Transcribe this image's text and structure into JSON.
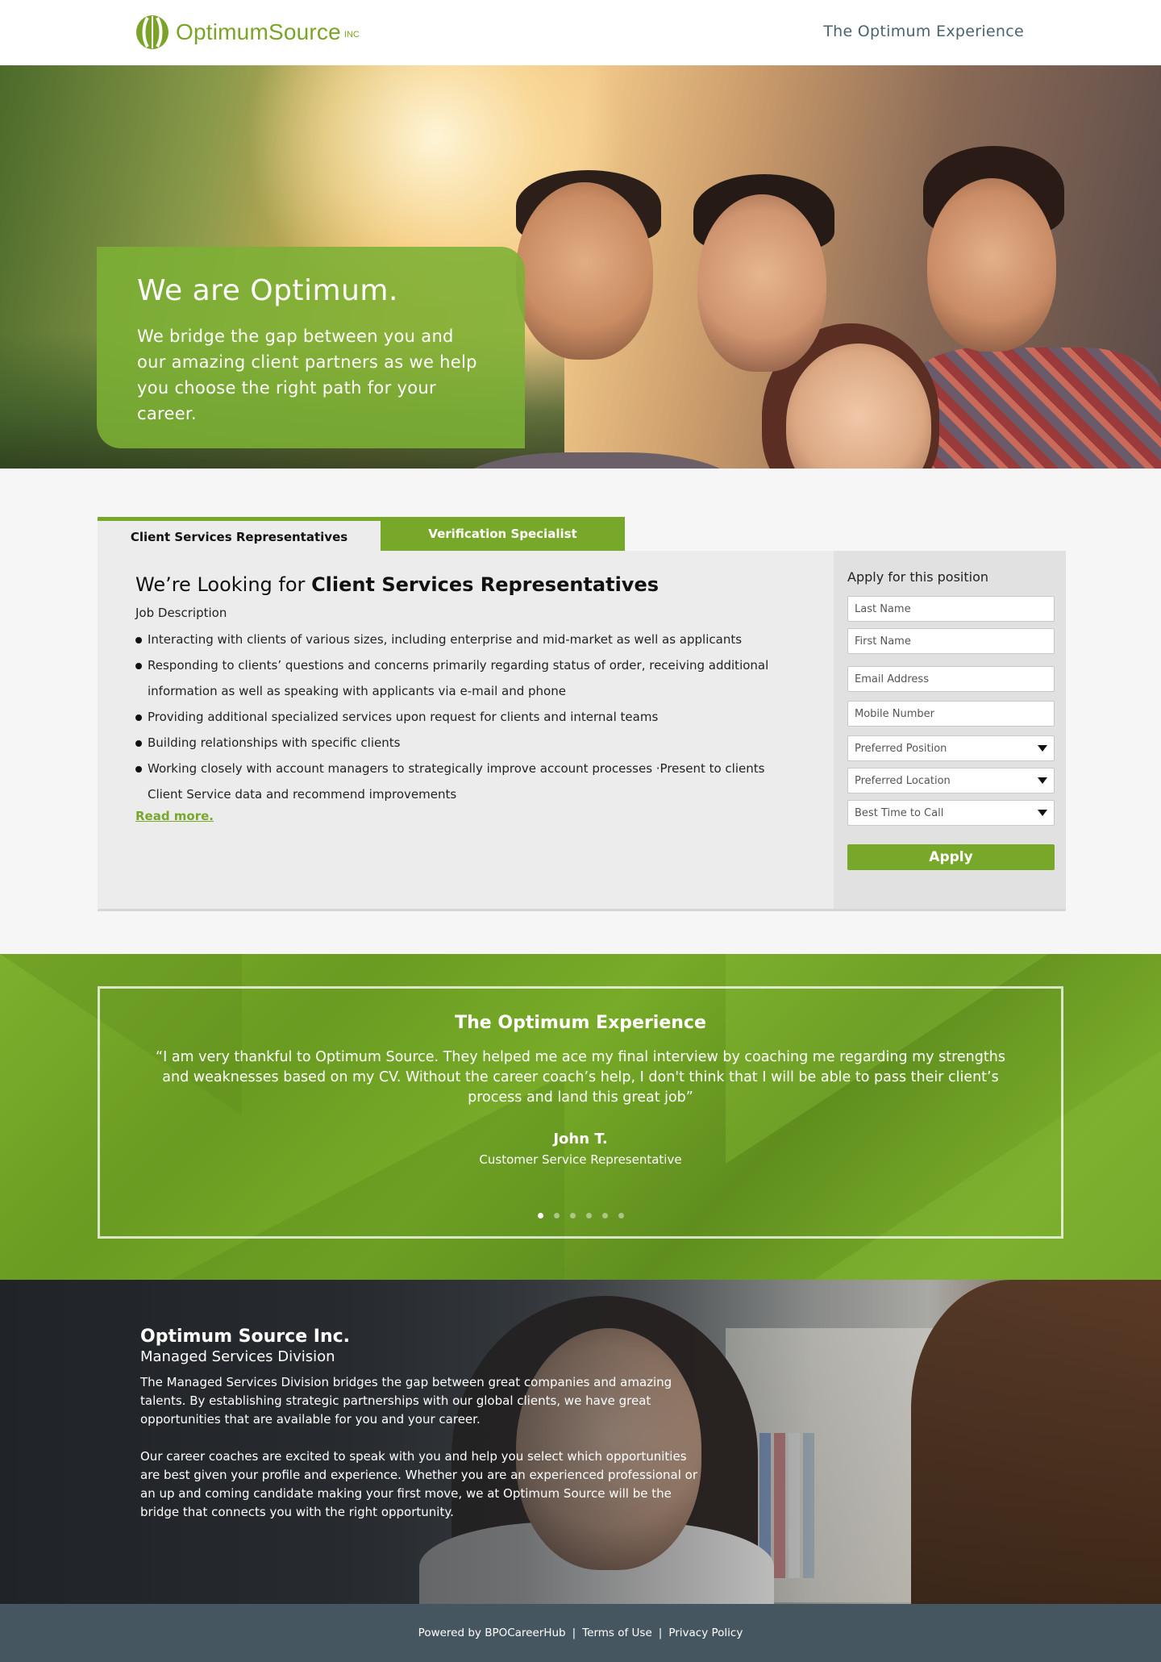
{
  "header": {
    "brand_name": "OptimumSource",
    "brand_suffix": "INC",
    "tagline": "The Optimum Experience",
    "brand_color": "#7aa428"
  },
  "hero": {
    "title": "We are Optimum.",
    "subtitle": "We bridge the gap between you and our amazing client partners as we help you choose the right path for your career."
  },
  "tabs": [
    {
      "label": "Client Services Representatives",
      "active": true
    },
    {
      "label": "Verification Specialist",
      "active": false
    }
  ],
  "job": {
    "title_prefix": "We’re Looking for",
    "title_bold": "Client Services Representatives",
    "description_label": "Job Description",
    "bullets": [
      "Interacting with clients of various sizes, including enterprise and mid-market as well as applicants",
      "Responding to clients’ questions and concerns primarily regarding status of order, receiving additional information as well as speaking with applicants via e-mail and phone",
      "Providing additional specialized services upon request for clients and internal teams",
      "Building relationships with specific clients",
      "Working closely with account managers to strategically improve account processes ·Present to clients Client Service data and recommend improvements"
    ],
    "read_more": "Read more."
  },
  "apply": {
    "title": "Apply for this position",
    "last_name_placeholder": "Last Name",
    "first_name_placeholder": "First Name",
    "email_placeholder": "Email Address",
    "mobile_placeholder": "Mobile Number",
    "position_select": "Preferred Position",
    "location_select": "Preferred Location",
    "time_select": "Best Time to Call",
    "button": "Apply"
  },
  "testimonial": {
    "title": "The Optimum Experience",
    "quote": "“I am very thankful to Optimum Source. They helped me ace my final interview by coaching  me regarding my strengths and weaknesses based on my CV. Without the career coach’s help, I don't think that I will be able to pass their client’s process and land this great job”",
    "name": "John T.",
    "role": "Customer Service Representative",
    "slide_count": 6,
    "active_slide": 1
  },
  "about": {
    "title": "Optimum Source Inc.",
    "subtitle": "Managed Services Division",
    "paragraphs": [
      "The Managed Services Division bridges the gap between great companies and amazing talents. By establishing strategic partnerships with our global clients, we have great opportunities that are available for you and your career.",
      "Our career coaches are excited to speak with you and help you select which opportunities are best given your profile and experience. Whether you are an experienced professional or an up and coming candidate making your first move, we at Optimum Source will be the bridge that connects you with the right opportunity."
    ]
  },
  "footer": {
    "powered_by": "Powered by BPOCareerHub",
    "separator": "|",
    "terms": "Terms of Use",
    "privacy": "Privacy Policy"
  }
}
